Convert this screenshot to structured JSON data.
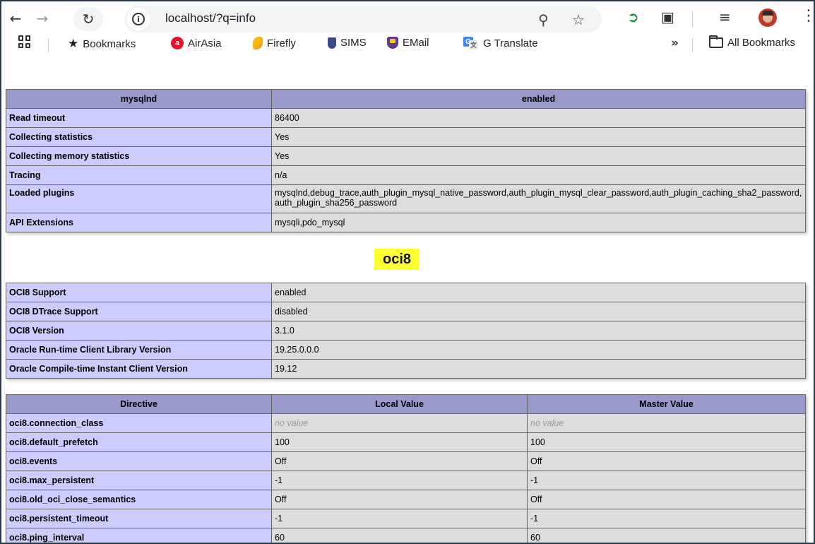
{
  "browser": {
    "url": "localhost/?q=info",
    "icons": {
      "back": "arrow-left-icon",
      "forward": "arrow-right-icon",
      "reload": "reload-icon",
      "site_info": "info-icon",
      "zoom": "zoom-icon",
      "bookmark_star": "star-icon",
      "signin": "signin-icon",
      "extensions": "puzzle-icon",
      "media": "media-queue-icon",
      "menu": "kebab-menu-icon"
    },
    "bookmarks": [
      {
        "label": "Bookmarks",
        "icon": "star-icon"
      },
      {
        "label": "AirAsia",
        "icon": "airasia-icon"
      },
      {
        "label": "Firefly",
        "icon": "firefly-icon"
      },
      {
        "label": "SIMS",
        "icon": "sims-icon"
      },
      {
        "label": "EMail",
        "icon": "email-icon"
      },
      {
        "label": "G Translate",
        "icon": "google-translate-icon"
      }
    ],
    "overflow_label": "»",
    "all_bookmarks_label": "All Bookmarks"
  },
  "mysqlnd": {
    "header": [
      "mysqlnd",
      "enabled"
    ],
    "rows": [
      {
        "key": "Read timeout",
        "value": "86400"
      },
      {
        "key": "Collecting statistics",
        "value": "Yes"
      },
      {
        "key": "Collecting memory statistics",
        "value": "Yes"
      },
      {
        "key": "Tracing",
        "value": "n/a"
      },
      {
        "key": "Loaded plugins",
        "value": "mysqlnd,debug_trace,auth_plugin_mysql_native_password,auth_plugin_mysql_clear_password,auth_plugin_caching_sha2_password,auth_plugin_sha256_password"
      },
      {
        "key": "API Extensions",
        "value": "mysqli,pdo_mysql"
      }
    ]
  },
  "oci8": {
    "title": "oci8",
    "info_rows": [
      {
        "key": "OCI8 Support",
        "value": "enabled"
      },
      {
        "key": "OCI8 DTrace Support",
        "value": "disabled"
      },
      {
        "key": "OCI8 Version",
        "value": "3.1.0"
      },
      {
        "key": "Oracle Run-time Client Library Version",
        "value": "19.25.0.0.0"
      },
      {
        "key": "Oracle Compile-time Instant Client Version",
        "value": "19.12"
      }
    ],
    "directive_header": [
      "Directive",
      "Local Value",
      "Master Value"
    ],
    "directives": [
      {
        "name": "oci8.connection_class",
        "local": "no value",
        "master": "no value"
      },
      {
        "name": "oci8.default_prefetch",
        "local": "100",
        "master": "100"
      },
      {
        "name": "oci8.events",
        "local": "Off",
        "master": "Off"
      },
      {
        "name": "oci8.max_persistent",
        "local": "-1",
        "master": "-1"
      },
      {
        "name": "oci8.old_oci_close_semantics",
        "local": "Off",
        "master": "Off"
      },
      {
        "name": "oci8.persistent_timeout",
        "local": "-1",
        "master": "-1"
      },
      {
        "name": "oci8.ping_interval",
        "local": "60",
        "master": "60"
      }
    ]
  },
  "colors": {
    "header_bg": "#9999cc",
    "key_bg": "#ccccff",
    "value_bg": "#dddddd",
    "highlight": "#ffff33"
  }
}
